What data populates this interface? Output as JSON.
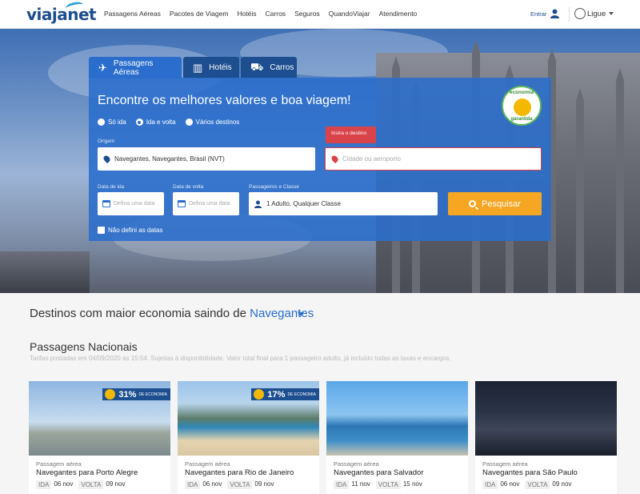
{
  "header": {
    "logo": "viajanet",
    "nav": [
      "Passagens Aéreas",
      "Pacotes de Viagem",
      "Hotéis",
      "Carros",
      "Seguros",
      "QuandoViajar",
      "Atendimento"
    ],
    "entrar": "Entrar",
    "ligue": "Ligue"
  },
  "search": {
    "tabs": [
      {
        "label": "Passagens Aéreas",
        "icon": "airplane-icon",
        "active": true
      },
      {
        "label": "Hotéis",
        "icon": "hotel-icon",
        "active": false
      },
      {
        "label": "Carros",
        "icon": "car-icon",
        "active": false
      }
    ],
    "title": "Encontre os melhores valores e boa viagem!",
    "badge_top": "economia",
    "badge_bottom": "garantida",
    "trip_types": [
      "Só ida",
      "Ida e volta",
      "Vários destinos"
    ],
    "trip_selected": "Ida e volta",
    "origin_label": "Origem",
    "origin_value": "Navegantes, Navegantes, Brasil (NVT)",
    "destination_tooltip": "Insira o destino",
    "destination_placeholder": "Cidade ou aeroporto",
    "depart_label": "Data de ida",
    "depart_placeholder": "Defina uma data",
    "return_label": "Data de volta",
    "return_placeholder": "Defina uma data",
    "pax_label": "Passageiros e Classe",
    "pax_value": "1 Adulto, Qualquer Classe",
    "search_button": "Pesquisar",
    "undefined_dates": "Não defini as datas"
  },
  "destinations": {
    "title_prefix": "Destinos com maior economia saindo de",
    "city": "Navegantes",
    "section_title": "Passagens Nacionais",
    "disclaimer": "Tarifas postadas em 04/09/2020 às 15:54. Sujeitas à disponibilidade. Valor total final para 1 passageiro adulto, já incluído todas as taxas e encargos.",
    "cards": [
      {
        "type": "Passagem aérea",
        "dest": "Navegantes para Porto Alegre",
        "ida_label": "IDA",
        "ida": "06 nov",
        "volta_label": "VOLTA",
        "volta": "09 nov",
        "economy": "31%",
        "economy_label": "DE ECONOMIA"
      },
      {
        "type": "Passagem aérea",
        "dest": "Navegantes para Rio de Janeiro",
        "ida_label": "IDA",
        "ida": "06 nov",
        "volta_label": "VOLTA",
        "volta": "09 nov",
        "economy": "17%",
        "economy_label": "DE ECONOMIA"
      },
      {
        "type": "Passagem aérea",
        "dest": "Navegantes para Salvador",
        "ida_label": "IDA",
        "ida": "11 nov",
        "volta_label": "VOLTA",
        "volta": "15 nov"
      },
      {
        "type": "Passagem aérea",
        "dest": "Navegantes para São Paulo",
        "ida_label": "IDA",
        "ida": "06 nov",
        "volta_label": "VOLTA",
        "volta": "09 nov"
      }
    ]
  },
  "colors": {
    "brand": "#1d4e8f",
    "accent": "#2a6dcc",
    "search_button": "#f5a623",
    "alert": "#d9434a"
  }
}
